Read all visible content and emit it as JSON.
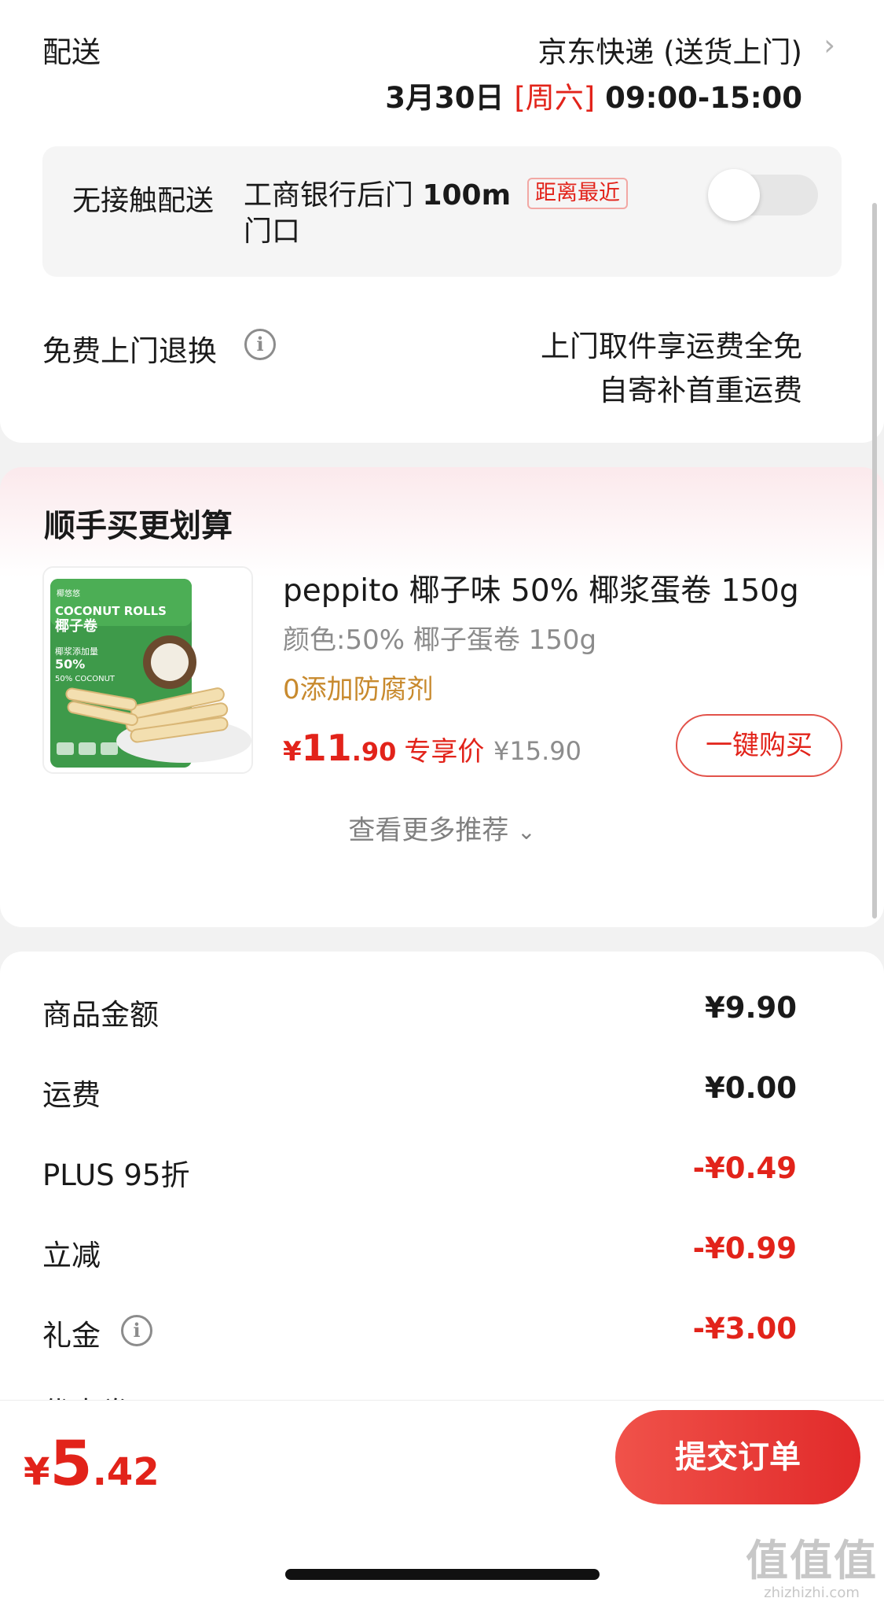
{
  "delivery": {
    "label": "配送",
    "method": "京东快递 (送货上门)",
    "date": "3月30日",
    "weekday": "[周六]",
    "time_window": "09:00-15:00",
    "contactless": {
      "label": "无接触配送",
      "address_prefix": "工商银行后门 ",
      "address_distance": "100m",
      "address_line2": "门口",
      "badge": "距离最近",
      "enabled": false
    },
    "returns": {
      "label": "免费上门退换",
      "line1": "上门取件享运费全免",
      "line2": "自寄补首重运费"
    }
  },
  "addon": {
    "title": "顺手买更划算",
    "product": {
      "name": "peppito 椰子味 50% 椰浆蛋卷 150g",
      "variant": "颜色:50% 椰子蛋卷 150g",
      "tag": "0添加防腐剂",
      "price_symbol": "¥",
      "price_int": "11",
      "price_dec": ".90",
      "price_label": "专享价",
      "original_price": "¥15.90",
      "image": {
        "brand": "椰悠悠",
        "title_en": "COCONUT ROLLS",
        "title_cn": "椰子卷",
        "claim_cn": "椰浆添加量",
        "claim_pct": "50%",
        "claim_en": "50% COCONUT"
      }
    },
    "buy_button": "一键购买",
    "more_link": "查看更多推荐"
  },
  "summary": {
    "rows": [
      {
        "label": "商品金额",
        "value": "¥9.90",
        "discount": false
      },
      {
        "label": "运费",
        "value": "¥0.00",
        "discount": false
      },
      {
        "label": "PLUS 95折",
        "value": "-¥0.49",
        "discount": true
      },
      {
        "label": "立减",
        "value": "-¥0.99",
        "discount": true
      },
      {
        "label": "礼金",
        "value": "-¥3.00",
        "discount": true
      }
    ],
    "partial_row": "优惠券"
  },
  "footer": {
    "total_symbol": "¥",
    "total_int": "5",
    "total_dec": ".42",
    "submit_label": "提交订单"
  },
  "watermark": {
    "mark": "值值值",
    "url": "zhizhizhi.com"
  },
  "colors": {
    "accent": "#e2231a",
    "tag": "#c88a2e",
    "muted": "#8c8c8c"
  }
}
